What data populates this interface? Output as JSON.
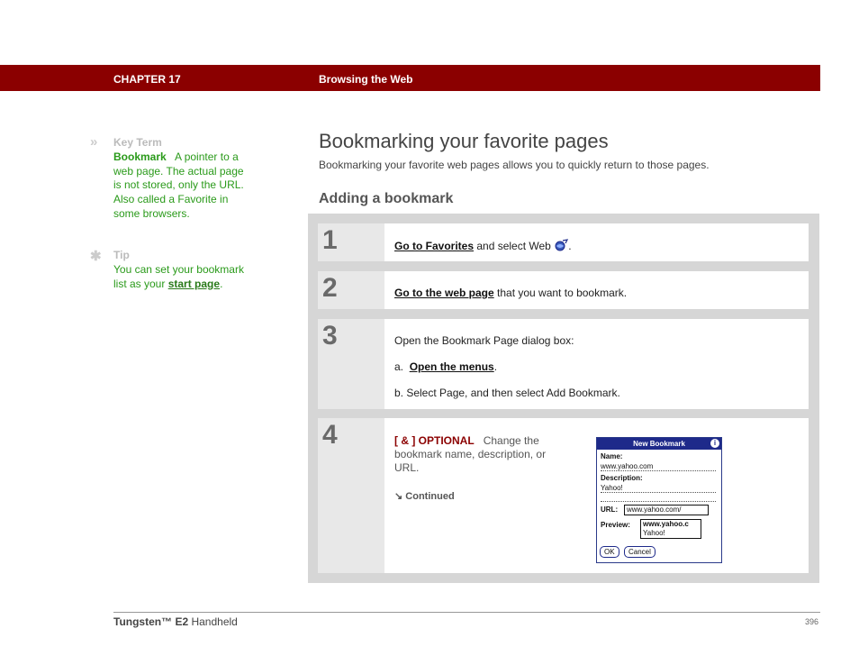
{
  "header": {
    "chapter": "CHAPTER 17",
    "section": "Browsing the Web",
    "bar_color": "#8b0000"
  },
  "sidebar": {
    "key_term": {
      "icon": "»",
      "heading": "Key Term",
      "term": "Bookmark",
      "definition": "A pointer to a web page. The actual page is not stored, only the URL. Also called a Favorite in some browsers."
    },
    "tip": {
      "icon": "✱",
      "heading": "Tip",
      "text": "You can set your bookmark list as your",
      "link": "start page",
      "period": "."
    }
  },
  "main": {
    "title": "Bookmarking your favorite pages",
    "intro": "Bookmarking your favorite web pages allows you to quickly return to those pages.",
    "subtitle": "Adding a bookmark",
    "steps": [
      {
        "number": "1",
        "link": "Go to Favorites",
        "text": "and select Web",
        "icon": "web-browser-icon",
        "end": "."
      },
      {
        "number": "2",
        "link": "Go to the web page",
        "text": "that you want to bookmark."
      },
      {
        "number": "3",
        "text": "Open the Bookmark Page dialog box:",
        "sub_a_prefix": "a.",
        "sub_a_link": "Open the menus",
        "sub_a_end": ".",
        "sub_b": "b.  Select Page, and then select Add Bookmark."
      },
      {
        "number": "4",
        "optional_tag": "[ & ]  OPTIONAL",
        "text": "Change the bookmark name, description, or URL.",
        "continued_icon": "↘",
        "continued": "Continued"
      }
    ]
  },
  "dialog": {
    "title": "New Bookmark",
    "info": "i",
    "name_label": "Name:",
    "name_value": "www.yahoo.com",
    "desc_label": "Description:",
    "desc_value": "Yahoo!",
    "url_label": "URL:",
    "url_value": "www.yahoo.com/",
    "preview_label": "Preview:",
    "preview_line1": "www.yahoo.c",
    "preview_line2": "Yahoo!",
    "ok": "OK",
    "cancel": "Cancel"
  },
  "footer": {
    "product_bold": "Tungsten™ E2",
    "product_rest": " Handheld",
    "page": "396"
  }
}
